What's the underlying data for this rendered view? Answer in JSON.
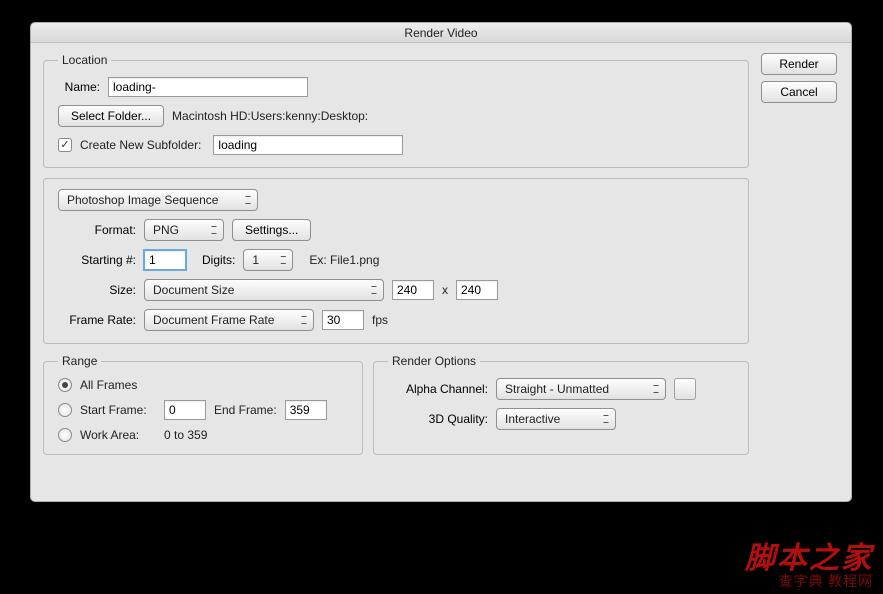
{
  "window": {
    "title": "Render Video"
  },
  "buttons": {
    "render": "Render",
    "cancel": "Cancel",
    "selectFolder": "Select Folder...",
    "settings": "Settings..."
  },
  "location": {
    "legend": "Location",
    "nameLabel": "Name:",
    "nameValue": "loading-",
    "path": "Macintosh HD:Users:kenny:Desktop:",
    "createSubfolderLabel": "Create New Subfolder:",
    "subfolderValue": "loading"
  },
  "output": {
    "sequenceType": "Photoshop Image Sequence",
    "formatLabel": "Format:",
    "formatValue": "PNG",
    "startingLabel": "Starting #:",
    "startingValue": "1",
    "digitsLabel": "Digits:",
    "digitsValue": "1",
    "exampleLabel": "Ex: File1.png",
    "sizeLabel": "Size:",
    "sizeValue": "Document Size",
    "width": "240",
    "height": "240",
    "timesSep": "x",
    "frameRateLabel": "Frame Rate:",
    "frameRateValue": "Document Frame Rate",
    "fpsValue": "30",
    "fpsLabel": "fps"
  },
  "range": {
    "legend": "Range",
    "allFrames": "All Frames",
    "startFrameLabel": "Start Frame:",
    "startFrameValue": "0",
    "endFrameLabel": "End Frame:",
    "endFrameValue": "359",
    "workAreaLabel": "Work Area:",
    "workAreaRange": "0 to 359"
  },
  "renderOptions": {
    "legend": "Render Options",
    "alphaLabel": "Alpha Channel:",
    "alphaValue": "Straight - Unmatted",
    "qualityLabel": "3D Quality:",
    "qualityValue": "Interactive"
  },
  "watermark": {
    "line1": "脚本之家",
    "line2": "查字典  教程网"
  }
}
